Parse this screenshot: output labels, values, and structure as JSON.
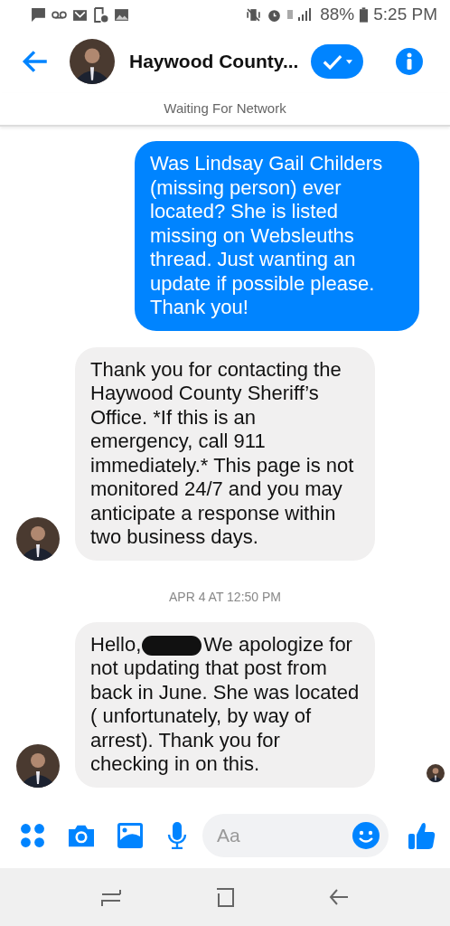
{
  "status_bar": {
    "battery": "88%",
    "time": "5:25 PM"
  },
  "header": {
    "title": "Haywood County...",
    "network_notice": "Waiting For Network"
  },
  "messages": [
    {
      "kind": "outgoing",
      "text": "Was Lindsay Gail Childers (missing person) ever located?  She is listed missing on Websleuths thread.  Just wanting an update if possible please.  Thank you!"
    },
    {
      "kind": "incoming",
      "avatar": true,
      "text": "Thank you for contacting the Haywood County Sheriff’s Office. *If this is an emergency, call 911 immediately.*  This page is not monitored 24/7 and you may anticipate a response within two business days."
    },
    {
      "kind": "timestamp",
      "text": "APR 4 AT 12:50 PM"
    },
    {
      "kind": "incoming",
      "avatar": true,
      "text_before": "Hello,",
      "redacted": true,
      "text": "We apologize for not updating that post from back in June. She was located ( unfortunately, by way of arrest). Thank you for checking in on this."
    }
  ],
  "seen": true,
  "composer": {
    "placeholder": "Aa"
  }
}
